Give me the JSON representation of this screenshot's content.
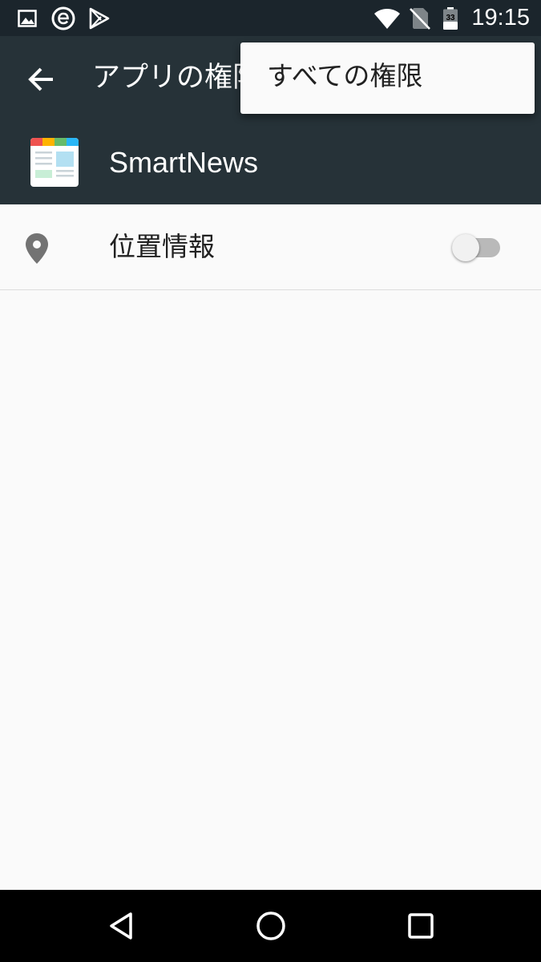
{
  "status_bar": {
    "time": "19:15",
    "battery_level": "33",
    "icons": [
      "image-icon",
      "e-icon",
      "play-store-icon",
      "wifi-icon",
      "no-sim-icon",
      "battery-icon"
    ]
  },
  "toolbar": {
    "title": "アプリの権限",
    "back_icon": "arrow-back-icon"
  },
  "app_header": {
    "name": "SmartNews",
    "icon": "smartnews-app-icon"
  },
  "permissions": [
    {
      "label": "位置情報",
      "icon": "location-pin-icon",
      "enabled": false
    }
  ],
  "overflow_menu": {
    "items": [
      {
        "label": "すべての権限"
      }
    ]
  },
  "nav_bar": {
    "icons": [
      "back-triangle-icon",
      "home-circle-icon",
      "recents-square-icon"
    ]
  },
  "colors": {
    "toolbar": "#263238",
    "status_bar": "#1b252c",
    "background": "#fafafa",
    "switch_track_off": "#b9b9b9",
    "switch_thumb_off": "#f1f1f1"
  }
}
